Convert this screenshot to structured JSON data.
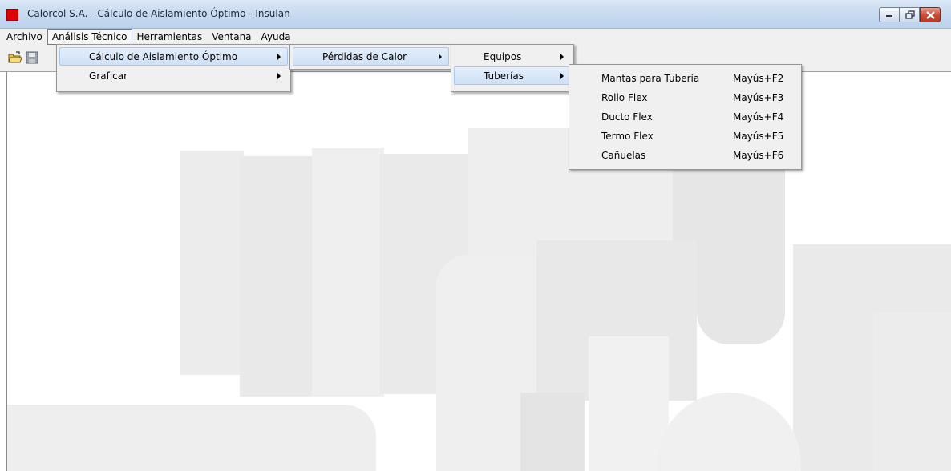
{
  "window": {
    "title": "Calorcol S.A. - Cálculo de Aislamiento Óptimo - Insulan",
    "icon": "app-red-square-icon"
  },
  "menubar": {
    "items": [
      "Archivo",
      "Análisis Técnico",
      "Herramientas",
      "Ventana",
      "Ayuda"
    ],
    "active": "Análisis Técnico"
  },
  "toolbar": {
    "buttons": [
      "open-folder-icon",
      "save-disk-icon"
    ]
  },
  "menus": {
    "analisis": [
      "Cálculo de Aislamiento Óptimo",
      "Graficar"
    ],
    "calculo": [
      "Pérdidas de Calor"
    ],
    "perdidas": [
      "Equipos",
      "Tuberías"
    ],
    "tuberias": [
      {
        "label": "Mantas para Tubería",
        "shortcut": "Mayús+F2"
      },
      {
        "label": "Rollo Flex",
        "shortcut": "Mayús+F3"
      },
      {
        "label": "Ducto Flex",
        "shortcut": "Mayús+F4"
      },
      {
        "label": "Termo Flex",
        "shortcut": "Mayús+F5"
      },
      {
        "label": "Cañuelas",
        "shortcut": "Mayús+F6"
      }
    ]
  },
  "colors": {
    "close_button": "#c84a35",
    "app_icon": "#e00000",
    "menu_highlight": "#cfe1f6"
  }
}
